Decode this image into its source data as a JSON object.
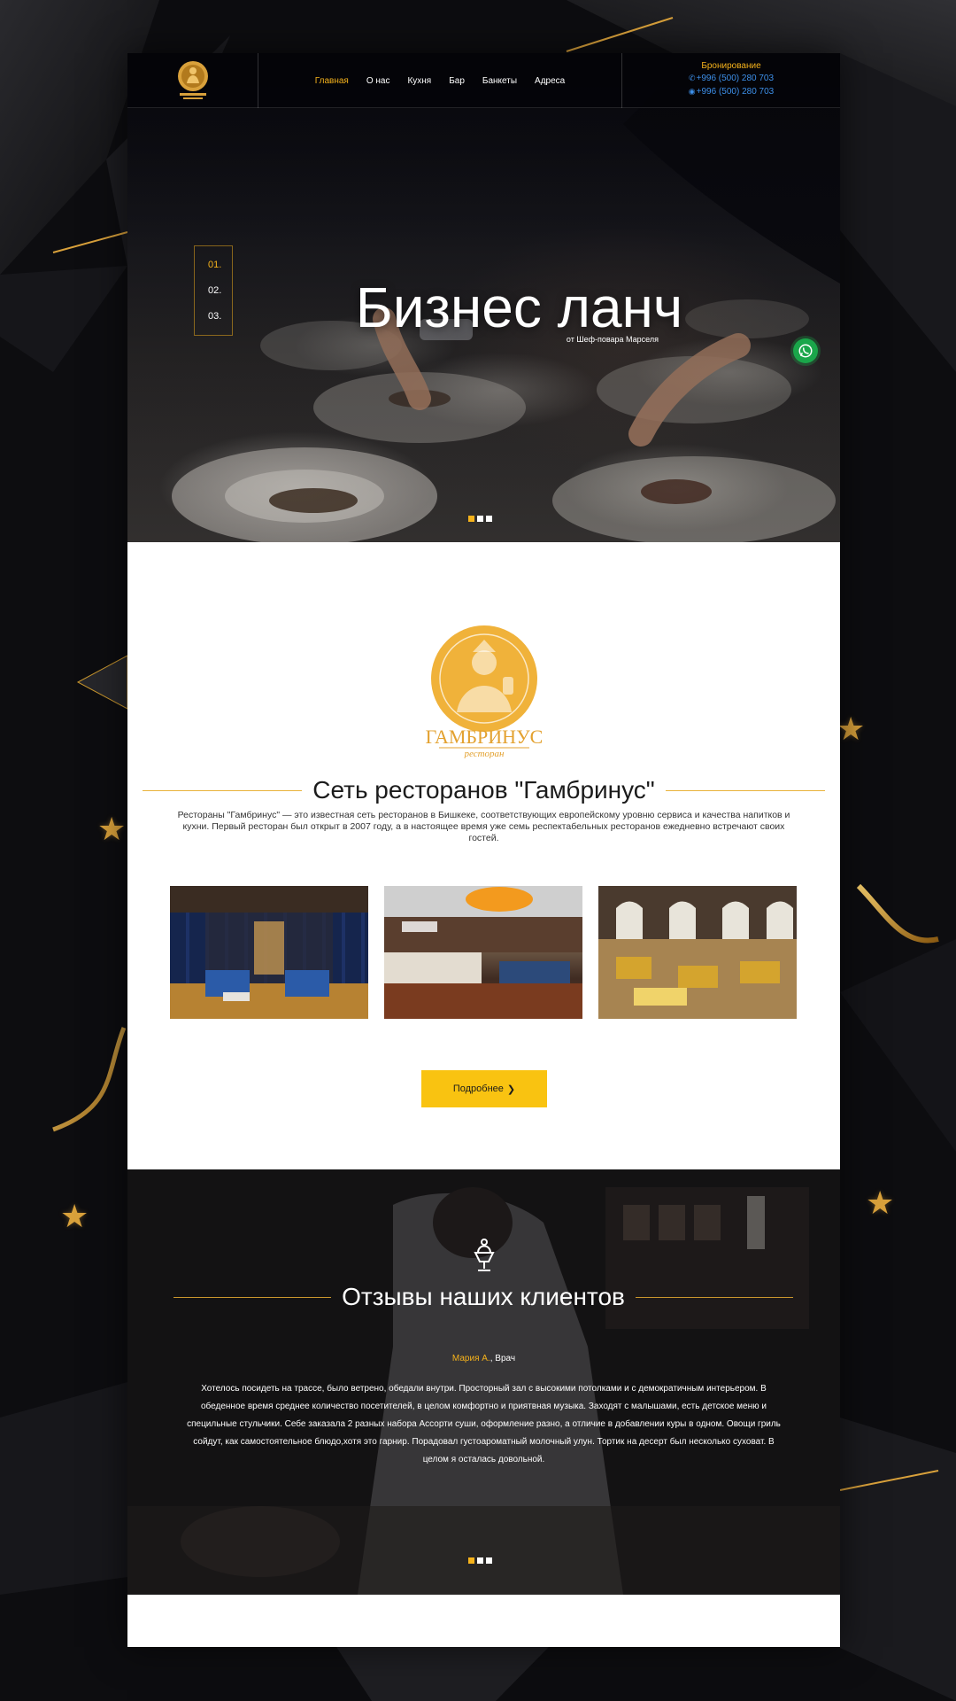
{
  "header": {
    "logo_alt": "ГАМБРИНУС",
    "nav": [
      {
        "label": "Главная",
        "active": true
      },
      {
        "label": "О нас",
        "active": false
      },
      {
        "label": "Кухня",
        "active": false
      },
      {
        "label": "Бар",
        "active": false
      },
      {
        "label": "Банкеты",
        "active": false
      },
      {
        "label": "Адреса",
        "active": false
      }
    ],
    "booking": {
      "title": "Бронирование",
      "phone1": "+996 (500) 280 703",
      "phone2": "+996 (500) 280 703"
    }
  },
  "hero": {
    "slides": [
      "01.",
      "02.",
      "03."
    ],
    "active_slide": 0,
    "title": "Бизнес ланч",
    "subtitle": "от Шеф-повара Марселя"
  },
  "about": {
    "logo_text": "ГАМБРИНУС",
    "logo_sub": "ресторан",
    "title": "Сеть ресторанов \"Гамбринус\"",
    "text": "Рестораны \"Гамбринус\" — это известная сеть ресторанов в Бишкеке, соответствующих европейскому уровню сервиса и качества напитков и кухни. Первый ресторан был открыт в 2007 году, а в настоящее время уже семь респектабельных ресторанов ежедневно встречают своих гостей.",
    "more_button": "Подробнее"
  },
  "reviews": {
    "title": "Отзывы наших клиентов",
    "reviewer_name": "Мария А.",
    "reviewer_role": ", Врач",
    "text": "Хотелось посидеть на трассе, было ветрено, обедали внутри. Просторный зал с высокими потолками и с демократичным интерьером. В обеденное время среднее количество посетителей, в целом комфортно и приятвная музыка. Заходят с малышами, есть детское меню и специльные стульчики. Себе заказала 2 разных набора Ассорти суши, оформление разно, а отличие в добавлении куры в одном. Овощи гриль сойдут, как самостоятельное блюдо,хотя это гарнир. Порадовал густоароматный молочный улун. Тортик на десерт был несколько суховат. В целом я осталась довольной."
  },
  "colors": {
    "accent": "#f5b21b",
    "button": "#f9c311",
    "phone": "#3d8fe8",
    "whatsapp": "#1aa64a"
  },
  "icons": [
    "phone-icon",
    "whatsapp-icon",
    "chevron-right-icon",
    "ice-cream-icon",
    "star-icon"
  ]
}
